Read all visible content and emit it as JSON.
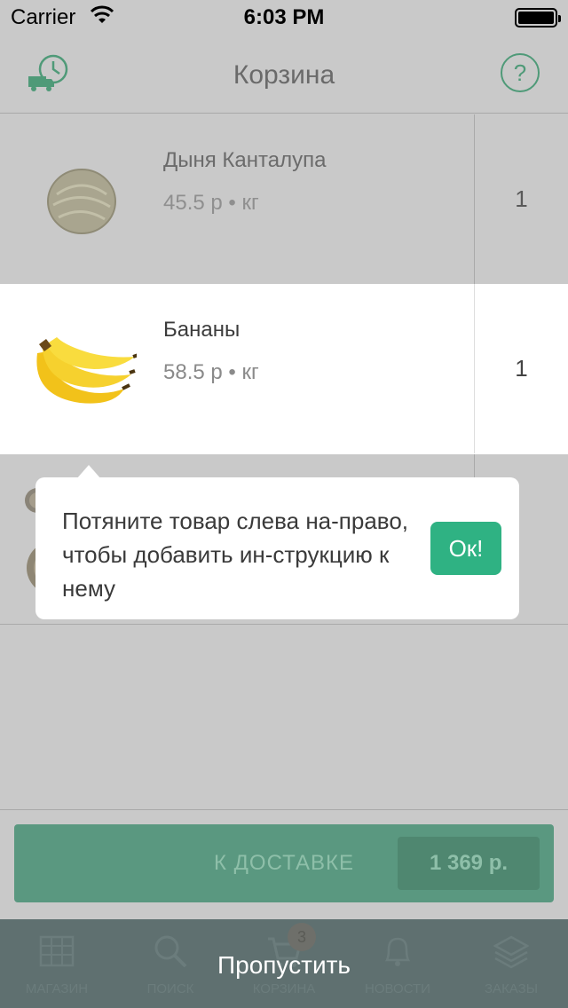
{
  "status_bar": {
    "carrier": "Carrier",
    "time": "6:03 PM"
  },
  "nav": {
    "title": "Корзина",
    "help_label": "?"
  },
  "cart": {
    "items": [
      {
        "name": "Дыня Канталупа",
        "price": "45.5 р • кг",
        "qty": "1",
        "icon": "cantaloupe-icon"
      },
      {
        "name": "Бананы",
        "price": "58.5 р • кг",
        "qty": "1",
        "icon": "banana-icon"
      }
    ]
  },
  "tooltip": {
    "message": "Потяните товар слева на-право, чтобы добавить ин-струкцию к нему",
    "ok_label": "Ок!"
  },
  "checkout": {
    "label": "К ДОСТАВКЕ",
    "total": "1 369 р."
  },
  "tabs": [
    {
      "label": "МАГАЗИН",
      "icon": "store-icon"
    },
    {
      "label": "ПОИСК",
      "icon": "search-icon"
    },
    {
      "label": "КОРЗИНА",
      "icon": "cart-icon"
    },
    {
      "label": "НОВОСТИ",
      "icon": "bell-icon"
    },
    {
      "label": "ЗАКАЗЫ",
      "icon": "orders-icon"
    }
  ],
  "cart_badge": "3",
  "skip_label": "Пропустить",
  "colors": {
    "accent": "#2fb283",
    "overlay": "#c9c9c9",
    "checkout_dim": "#5a9880",
    "tabbar": "#5f7070"
  }
}
